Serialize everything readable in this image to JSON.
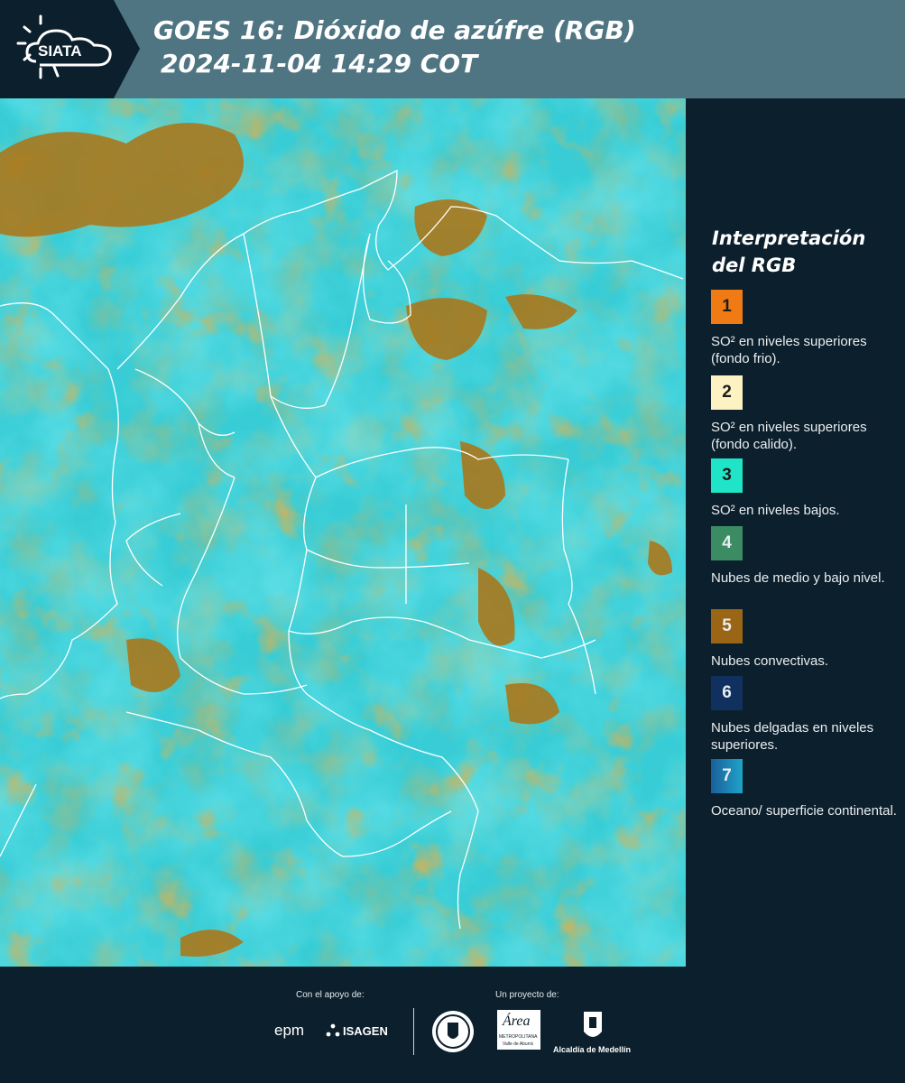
{
  "header": {
    "logo_text": "SIATA",
    "title_line1": "GOES 16: Dióxido de azúfre (RGB)",
    "title_line2": "2024-11-04 14:29 COT"
  },
  "legend": {
    "title": "Interpretación del RGB",
    "items": [
      {
        "number": "1",
        "color": "#f07a14",
        "text": "SO² en niveles superiores (fondo frio)."
      },
      {
        "number": "2",
        "color": "#fdf3c2",
        "text": "SO² en niveles superiores (fondo calido)."
      },
      {
        "number": "3",
        "color": "#20e4c8",
        "text": "SO² en niveles bajos."
      },
      {
        "number": "4",
        "color": "#3b8c63",
        "text": "Nubes de medio y bajo nivel."
      },
      {
        "number": "5",
        "color": "#9a6514",
        "text": "Nubes convectivas."
      },
      {
        "number": "6",
        "color": "#10305f",
        "text": "Nubes delgadas en niveles superiores."
      },
      {
        "number": "7",
        "color": "#1b86b8",
        "text": "Oceano/ superficie continental."
      }
    ]
  },
  "footer": {
    "support_label": "Con el apoyo de:",
    "project_label": "Un proyecto de:",
    "sponsor_epm": "epm",
    "sponsor_isagen": "ISAGEN",
    "area_metro": "Área",
    "area_metro_caption": "METROPOLITANA",
    "area_metro_subcaption": "Valle de Aburrá",
    "alcaldia": "Alcaldía de Medellín"
  },
  "map": {
    "colors": {
      "cyan_low": "#2fd6e0",
      "green_mid": "#3f8a4e",
      "brown_conv": "#a0731a",
      "border": "#ffffff"
    }
  }
}
